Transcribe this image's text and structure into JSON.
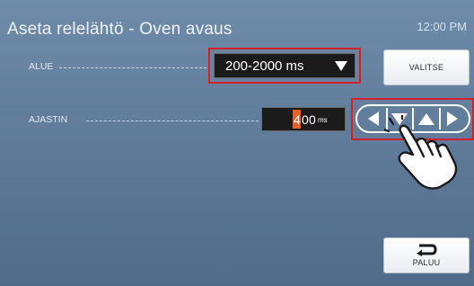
{
  "header": {
    "title": "Aseta relelähtö - Oven avaus",
    "clock": "12:00 PM"
  },
  "range_row": {
    "label": "ALUE",
    "selected_value": "200-2000 ms"
  },
  "select_button": {
    "label": "VALITSE"
  },
  "timer_row": {
    "label": "AJASTIN",
    "digit_1": "4",
    "digit_2": "0",
    "digit_3": "0",
    "unit": "ms"
  },
  "arrow_pad": {
    "icons": [
      "arrow-left",
      "arrow-down",
      "arrow-up",
      "arrow-right"
    ]
  },
  "back_button": {
    "label": "PALUU",
    "icon": "return-icon"
  },
  "colors": {
    "background": "#5f7c9b",
    "highlight_border": "#d3202c",
    "cursor": "#e4622c",
    "field_background": "#1b1b1b"
  }
}
